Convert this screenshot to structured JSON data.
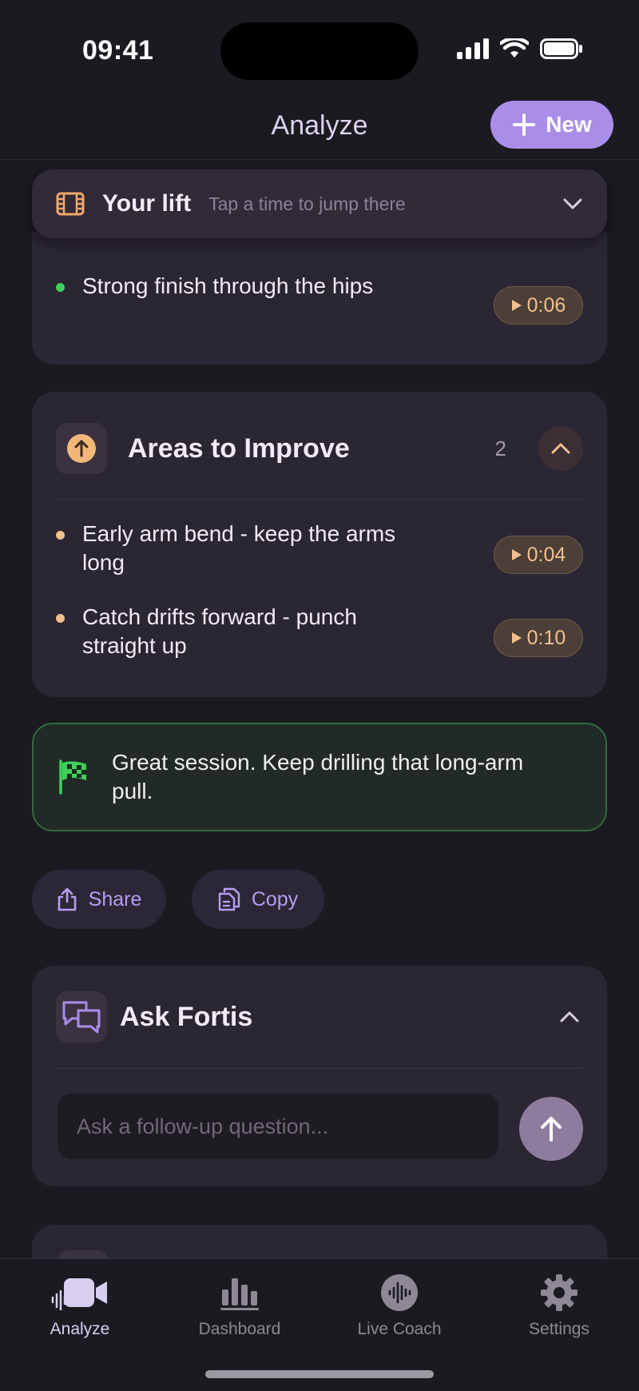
{
  "status_bar": {
    "time": "09:41"
  },
  "header": {
    "title": "Analyze",
    "new_button": "New"
  },
  "lift": {
    "title": "Your lift",
    "hint": "Tap a time to jump there",
    "items": [
      {
        "text": "Strong finish through the hips",
        "time": "0:06",
        "dot_color": "#3fcf5a"
      }
    ]
  },
  "improve": {
    "title": "Areas to Improve",
    "count": "2",
    "items": [
      {
        "text": "Early arm bend - keep the arms long",
        "time": "0:04",
        "dot_color": "#f2c08c"
      },
      {
        "text": "Catch drifts forward - punch straight up",
        "time": "0:10",
        "dot_color": "#f2c08c"
      }
    ]
  },
  "summary": {
    "text": "Great session. Keep drilling that long-arm pull."
  },
  "actions": {
    "share": "Share",
    "copy": "Copy"
  },
  "ask": {
    "title": "Ask Fortis",
    "placeholder": "Ask a follow-up question..."
  },
  "tabs": [
    {
      "label": "Analyze",
      "active": true
    },
    {
      "label": "Dashboard",
      "active": false
    },
    {
      "label": "Live Coach",
      "active": false
    },
    {
      "label": "Settings",
      "active": false
    }
  ],
  "colors": {
    "accent": "#a98de9",
    "time_pill_text": "#f2c08c",
    "success_border": "#2e6b3f"
  }
}
